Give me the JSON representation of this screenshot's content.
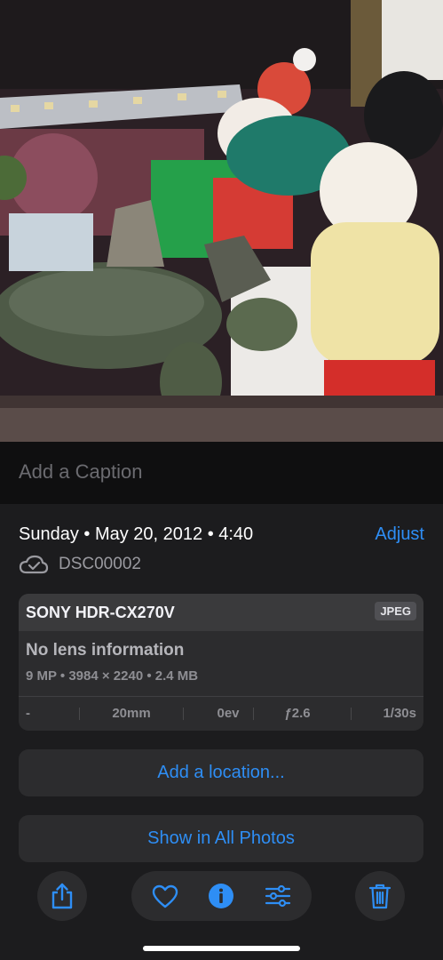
{
  "caption": {
    "placeholder": "Add a Caption"
  },
  "info": {
    "date": "Sunday • May 20, 2012 • 4:40",
    "adjust_label": "Adjust",
    "filename": "DSC00002",
    "cloud_icon": "cloud-check-icon"
  },
  "metadata": {
    "camera": "SONY HDR-CX270V",
    "format_badge": "JPEG",
    "lens": "No lens information",
    "specs": "9 MP • 3984 × 2240 • 2.4 MB",
    "exif": {
      "iso": "-",
      "focal_length": "20mm",
      "exposure": "0ev",
      "aperture": "ƒ2.6",
      "shutter": "1/30s"
    }
  },
  "actions": {
    "add_location": "Add a location...",
    "show_all_photos": "Show in All Photos"
  },
  "toolbar": {
    "share_icon": "share-icon",
    "favorite_icon": "heart-icon",
    "info_icon": "info-icon",
    "edit_icon": "sliders-icon",
    "delete_icon": "trash-icon"
  },
  "colors": {
    "accent": "#2e8ef5",
    "panel": "#1c1c1e",
    "card": "#2c2c2e"
  }
}
